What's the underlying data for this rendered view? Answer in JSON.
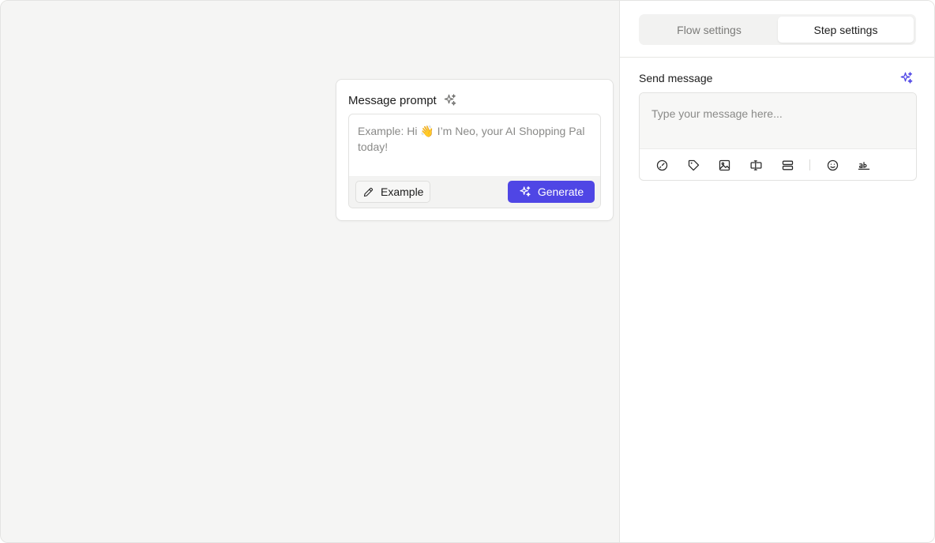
{
  "canvas": {
    "prompt_card": {
      "title": "Message prompt",
      "title_icon": "sparkle-icon",
      "placeholder": "Example: Hi 👋 I’m Neo, your AI Shopping Pal today!",
      "example_label": "Example",
      "example_icon": "pencil-icon",
      "generate_label": "Generate",
      "generate_icon": "sparkle-icon"
    }
  },
  "panel": {
    "tabs": [
      {
        "label": "Flow settings",
        "active": false
      },
      {
        "label": "Step settings",
        "active": true
      }
    ],
    "section_title": "Send message",
    "section_icon": "sparkle-icon",
    "message_placeholder": "Type your message here...",
    "toolbar_icons": [
      "speed-icon",
      "tag-icon",
      "image-icon",
      "button-icon",
      "cards-icon",
      "emoji-icon",
      "variable-icon"
    ]
  },
  "colors": {
    "accent": "#4f46e5",
    "canvas_bg": "#f5f5f4",
    "text_muted": "#8a8a88"
  }
}
